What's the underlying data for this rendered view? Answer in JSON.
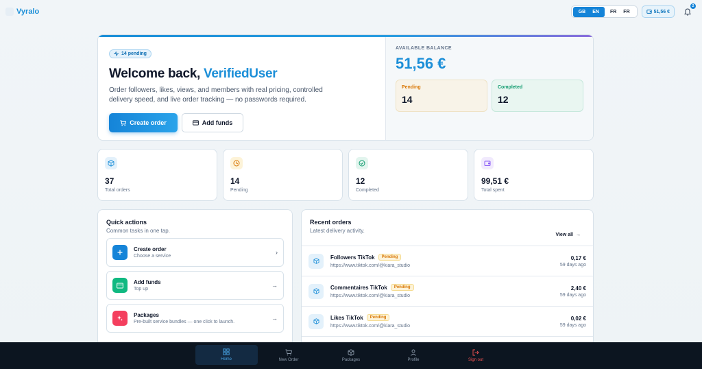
{
  "app": {
    "name": "Vyralo"
  },
  "header": {
    "lang_en": "EN",
    "lang_en_flag": "GB",
    "lang_fr": "FR",
    "lang_fr_flag": "FR",
    "balance": "51,56 €",
    "notification_count": "2"
  },
  "hero": {
    "pending_pill": "14 pending",
    "welcome_prefix": "Welcome back,",
    "username": "VerifiedUser",
    "description": "Order followers, likes, views, and members with real pricing, controlled delivery speed, and live order tracking — no passwords required.",
    "create_order": "Create order",
    "add_funds": "Add funds",
    "available_label": "AVAILABLE BALANCE",
    "available_value": "51,56 €",
    "pending_label": "Pending",
    "pending_value": "14",
    "completed_label": "Completed",
    "completed_value": "12"
  },
  "stats": [
    {
      "value": "37",
      "label": "Total orders",
      "icon": "box-icon",
      "color": "#1c8fd8"
    },
    {
      "value": "14",
      "label": "Pending",
      "icon": "clock-icon",
      "color": "#d97706"
    },
    {
      "value": "12",
      "label": "Completed",
      "icon": "check-circle-icon",
      "color": "#0f9b6e"
    },
    {
      "value": "99,51 €",
      "label": "Total spent",
      "icon": "wallet-icon",
      "color": "#8b5cf6"
    }
  ],
  "quick_actions": {
    "title": "Quick actions",
    "subtitle": "Common tasks in one tap.",
    "items": [
      {
        "title": "Create order",
        "sub": "Choose a service",
        "icon": "plus-icon",
        "color": "#1584d8"
      },
      {
        "title": "Add funds",
        "sub": "Top up",
        "icon": "card-icon",
        "color": "#10b981"
      },
      {
        "title": "Packages",
        "sub": "Pre-built service bundles — one click to launch.",
        "icon": "sparkle-icon",
        "color": "#f43f5e"
      }
    ]
  },
  "recent_orders": {
    "title": "Recent orders",
    "subtitle": "Latest delivery activity.",
    "view_all": "View all",
    "rows": [
      {
        "name": "Followers TikTok",
        "status": "Pending",
        "url": "https://www.tiktok.com/@kiara_studio",
        "price": "0,17 €",
        "ago": "59 days ago"
      },
      {
        "name": "Commentaires TikTok",
        "status": "Pending",
        "url": "https://www.tiktok.com/@kiara_studio",
        "price": "2,40 €",
        "ago": "59 days ago"
      },
      {
        "name": "Likes TikTok",
        "status": "Pending",
        "url": "https://www.tiktok.com/@kiara_studio",
        "price": "0,02 €",
        "ago": "59 days ago"
      }
    ]
  },
  "nav": {
    "home": "Home",
    "new_order": "New Order",
    "packages": "Packages",
    "profile": "Profile",
    "sign_out": "Sign out"
  }
}
